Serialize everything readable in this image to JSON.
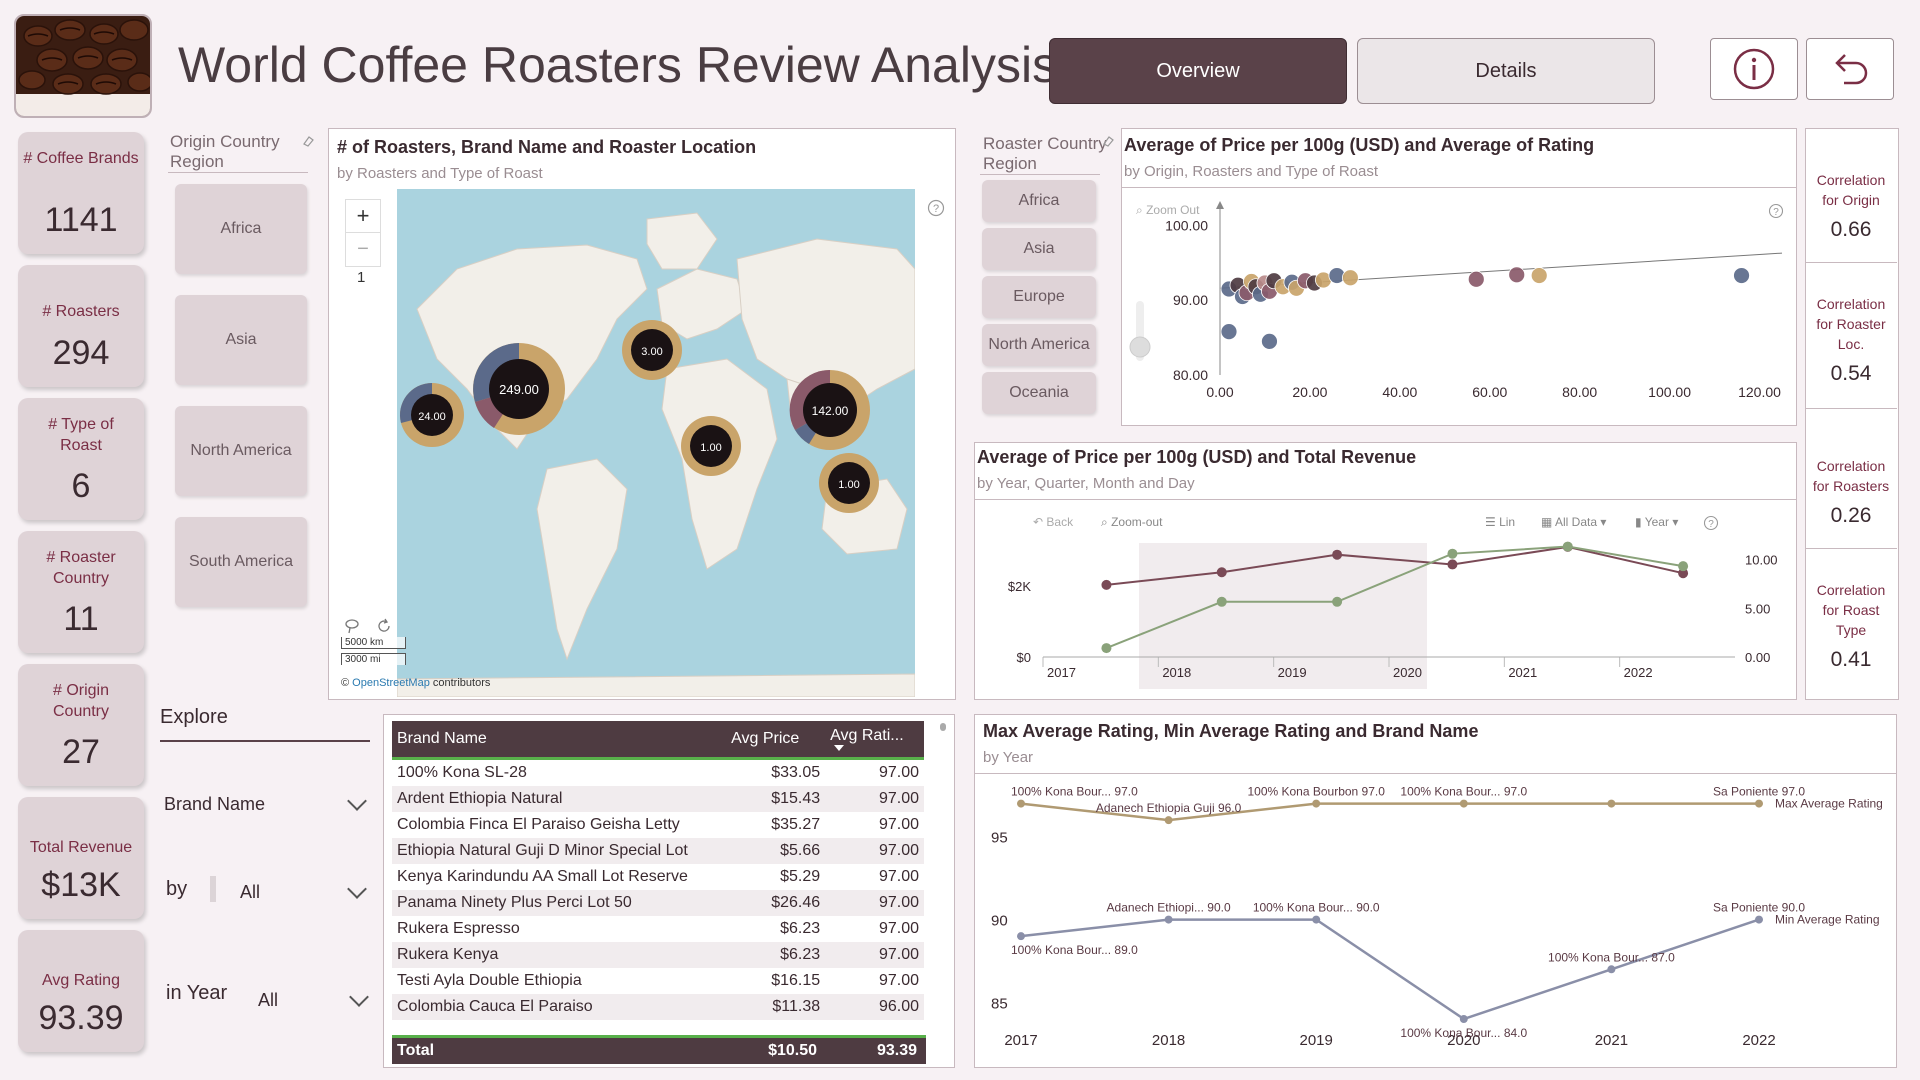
{
  "header": {
    "title": "World Coffee Roasters Review Analysis",
    "tabs": [
      {
        "label": "Overview",
        "active": true
      },
      {
        "label": "Details",
        "active": false
      }
    ],
    "info_icon": "info-icon",
    "back_icon": "undo-arrow-icon"
  },
  "kpis": [
    {
      "label": "# Coffee Brands",
      "value": "1141"
    },
    {
      "label": "# Roasters",
      "value": "294"
    },
    {
      "label": "# Type of Roast",
      "value": "6"
    },
    {
      "label": "# Roaster Country",
      "value": "11"
    },
    {
      "label": "# Origin Country",
      "value": "27"
    },
    {
      "label": "Total Revenue",
      "value": "$13K"
    },
    {
      "label": "Avg Rating",
      "value": "93.39"
    }
  ],
  "origin_slicer": {
    "title": "Origin Country Region",
    "items": [
      "Africa",
      "Asia",
      "North America",
      "South America"
    ]
  },
  "roaster_slicer": {
    "title": "Roaster Country Region",
    "items": [
      "Africa",
      "Asia",
      "Europe",
      "North America",
      "Oceania"
    ]
  },
  "map": {
    "title": "# of Roasters, Brand Name and Roaster Location",
    "subtitle": "by Roasters and Type of Roast",
    "zoom_in": "+",
    "zoom_out": "−",
    "zoom_level": "1",
    "scale_km": "5000 km",
    "scale_mi": "3000 mi",
    "attribution_prefix": "© ",
    "attribution_link": "OpenStreetMap",
    "attribution_suffix": " contributors",
    "bubbles": [
      {
        "label": "249.00"
      },
      {
        "label": "24.00"
      },
      {
        "label": "3.00"
      },
      {
        "label": "1.00"
      },
      {
        "label": "142.00"
      },
      {
        "label": "1.00"
      }
    ]
  },
  "explore": {
    "title": "Explore",
    "field": "Brand Name",
    "by_label": "by",
    "by_value": "All",
    "year_label": "in Year",
    "year_value": "All"
  },
  "table": {
    "columns": [
      "Brand Name",
      "Avg Price",
      "Avg Rati..."
    ],
    "rows": [
      [
        "100% Kona SL-28",
        "$33.05",
        "97.00"
      ],
      [
        "Ardent Ethiopia Natural",
        "$15.43",
        "97.00"
      ],
      [
        "Colombia Finca El Paraiso Geisha Letty",
        "$35.27",
        "97.00"
      ],
      [
        "Ethiopia Natural Guji D Minor Special Lot",
        "$5.66",
        "97.00"
      ],
      [
        "Kenya Karindundu AA Small Lot Reserve",
        "$5.29",
        "97.00"
      ],
      [
        "Panama Ninety Plus Perci Lot 50",
        "$26.46",
        "97.00"
      ],
      [
        "Rukera Espresso",
        "$6.23",
        "97.00"
      ],
      [
        "Rukera Kenya",
        "$6.23",
        "97.00"
      ],
      [
        "Testi Ayla Double Ethiopia",
        "$16.15",
        "97.00"
      ],
      [
        "Colombia Cauca El Paraiso",
        "$11.38",
        "96.00"
      ]
    ],
    "total": [
      "Total",
      "$10.50",
      "93.39"
    ]
  },
  "correlations": [
    {
      "label": "Correlation for Origin",
      "value": "0.66"
    },
    {
      "label": "Correlation for Roaster Loc.",
      "value": "0.54"
    },
    {
      "label": "Correlation for Roasters",
      "value": "0.26"
    },
    {
      "label": "Correlation for Roast Type",
      "value": "0.41"
    }
  ],
  "chart_data": [
    {
      "type": "scatter",
      "title": "Average of Price per 100g (USD) and Average of Rating",
      "subtitle": "by Origin, Roasters and Type of Roast",
      "toolbar_label": "Zoom Out",
      "xlim": [
        0,
        125
      ],
      "ylim": [
        80,
        103
      ],
      "xticks": [
        "0.00",
        "20.00",
        "40.00",
        "60.00",
        "80.00",
        "100.00",
        "120.00"
      ],
      "yticks": [
        "100.00",
        "90.00",
        "80.00"
      ],
      "points": [
        {
          "x": 2,
          "y": 91.5,
          "color": "#5b6a8a"
        },
        {
          "x": 4,
          "y": 92,
          "color": "#4e3b41"
        },
        {
          "x": 5,
          "y": 90.5,
          "color": "#5b6a8a"
        },
        {
          "x": 6,
          "y": 91,
          "color": "#8a5a6a"
        },
        {
          "x": 7,
          "y": 92.5,
          "color": "#c9a46a"
        },
        {
          "x": 8,
          "y": 91.8,
          "color": "#4e3b41"
        },
        {
          "x": 9,
          "y": 90.8,
          "color": "#5b6a8a"
        },
        {
          "x": 10,
          "y": 92.3,
          "color": "#b98a8a"
        },
        {
          "x": 11,
          "y": 91.2,
          "color": "#8a5a6a"
        },
        {
          "x": 12,
          "y": 92.6,
          "color": "#4e3b41"
        },
        {
          "x": 14,
          "y": 91.8,
          "color": "#c9a46a"
        },
        {
          "x": 16,
          "y": 92.4,
          "color": "#5b6a8a"
        },
        {
          "x": 17,
          "y": 91.6,
          "color": "#c9a46a"
        },
        {
          "x": 19,
          "y": 92.6,
          "color": "#8a5a6a"
        },
        {
          "x": 21,
          "y": 92.3,
          "color": "#4e3b41"
        },
        {
          "x": 23,
          "y": 92.7,
          "color": "#c9a46a"
        },
        {
          "x": 26,
          "y": 93.3,
          "color": "#5b6a8a"
        },
        {
          "x": 29,
          "y": 93.0,
          "color": "#c9a46a"
        },
        {
          "x": 2,
          "y": 85.8,
          "color": "#5b6a8a"
        },
        {
          "x": 11,
          "y": 84.5,
          "color": "#5b6a8a"
        },
        {
          "x": 57,
          "y": 92.8,
          "color": "#8a5a6a"
        },
        {
          "x": 66,
          "y": 93.4,
          "color": "#8a5a6a"
        },
        {
          "x": 71,
          "y": 93.3,
          "color": "#c9a46a"
        },
        {
          "x": 116,
          "y": 93.3,
          "color": "#5b6a8a"
        }
      ],
      "trendline": [
        {
          "x": 0,
          "y": 91.6
        },
        {
          "x": 125,
          "y": 96.3
        }
      ]
    },
    {
      "type": "line",
      "title": "Average of Price per 100g (USD) and Total Revenue",
      "subtitle": "by Year, Quarter, Month and Day",
      "toolbar": {
        "back": "Back",
        "zoom": "Zoom-out",
        "lin": "Lin",
        "all_data": "All Data",
        "year": "Year"
      },
      "categories": [
        "2017",
        "2018",
        "2019",
        "2020",
        "2021",
        "2022"
      ],
      "left_axis": {
        "ticks": [
          "$2K",
          "$0"
        ],
        "values": [
          2000,
          0
        ],
        "ylim": [
          0,
          3200
        ]
      },
      "right_axis": {
        "ticks": [
          "10.00",
          "5.00",
          "0.00"
        ],
        "values": [
          10,
          5,
          0
        ],
        "ylim": [
          0,
          11.7
        ]
      },
      "series": [
        {
          "name": "Average of Price per 100g (USD)",
          "axis": "right",
          "color": "#7a4a56",
          "values": [
            7.4,
            8.7,
            10.5,
            9.5,
            11.3,
            8.6
          ]
        },
        {
          "name": "Total Revenue",
          "axis": "left",
          "color": "#8aa27a",
          "values": [
            250,
            1550,
            1550,
            2900,
            3100,
            2550
          ]
        }
      ]
    },
    {
      "type": "line",
      "title": "Max Average Rating, Min Average Rating and Brand Name",
      "subtitle": "by Year",
      "categories": [
        "2017",
        "2018",
        "2019",
        "2020",
        "2021",
        "2022"
      ],
      "ylim": [
        84,
        98
      ],
      "yticks": [
        "95",
        "90",
        "85"
      ],
      "series": [
        {
          "name": "Max Average Rating",
          "color": "#b09a72",
          "values": [
            97.0,
            96.0,
            97.0,
            97.0,
            97.0,
            97.0
          ],
          "labels": [
            "100% Kona Bour... 97.0",
            "Adanech Ethiopia Guji 96.0",
            "100% Kona Bourbon 97.0",
            "100% Kona Bour... 97.0",
            "",
            "Sa Poniente 97.0"
          ]
        },
        {
          "name": "Min Average Rating",
          "color": "#8a8fa8",
          "values": [
            89.0,
            90.0,
            90.0,
            84.0,
            87.0,
            90.0
          ],
          "labels": [
            "100% Kona Bour... 89.0",
            "Adanech Ethiopi... 90.0",
            "100% Kona Bour... 90.0",
            "100% Kona Bour... 84.0",
            "100% Kona Bour... 87.0",
            "Sa Poniente 90.0"
          ]
        }
      ]
    }
  ]
}
